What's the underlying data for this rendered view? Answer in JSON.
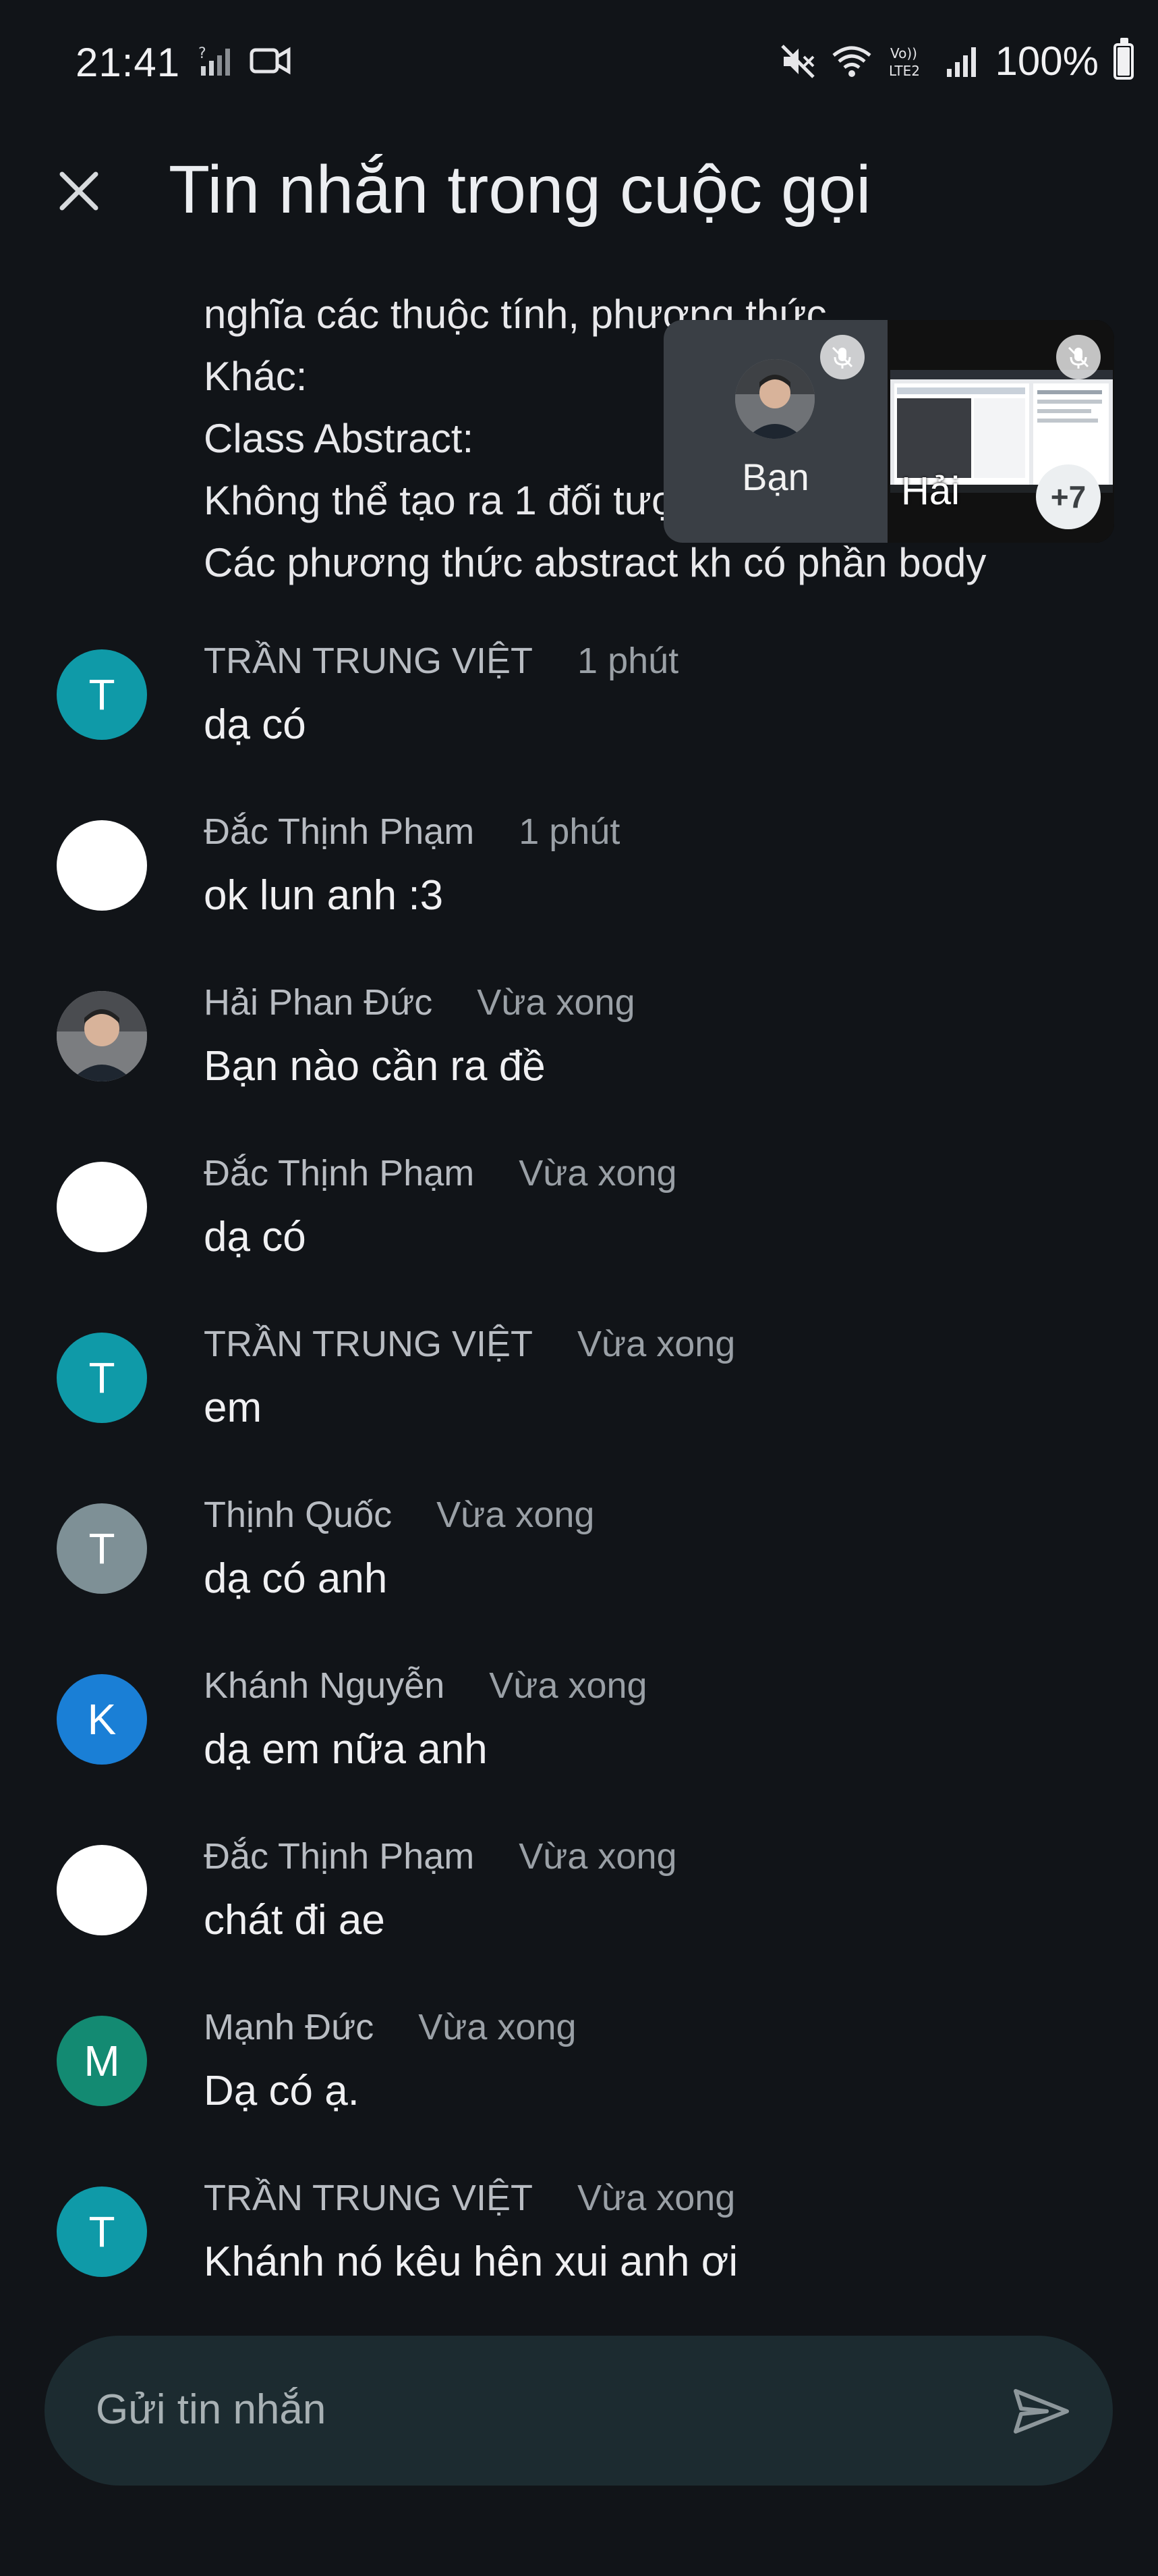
{
  "status_bar": {
    "time": "21:41",
    "battery": "100%",
    "icons": [
      "signal-off-icon",
      "video-camera-icon",
      "mute-icon",
      "wifi-icon",
      "volte-icon",
      "cell-signal-icon",
      "battery-icon"
    ],
    "volte_text": "Vo)) LTE2"
  },
  "header": {
    "close_icon": "close-icon",
    "title": "Tin nhắn trong cuộc gọi"
  },
  "partial_message": {
    "lines": [
      "nghĩa các thuộc tính, phương thức",
      "Khác:",
      "Class Abstract:",
      "Không thể tạo ra 1 đối tượng",
      "Các phương thức abstract kh có phần body"
    ]
  },
  "messages": [
    {
      "sender": "TRẦN TRUNG VIỆT",
      "time": "1 phút",
      "text": "dạ có",
      "initial": "T",
      "avatar_color": "#0f9aa8"
    },
    {
      "sender": "Đắc Thịnh Phạm",
      "time": "1 phút",
      "text": "ok lun anh :3",
      "initial": "",
      "avatar_color": "#ffffff"
    },
    {
      "sender": "Hải Phan Đức",
      "time": "Vừa xong",
      "text": "Bạn nào cần ra đề",
      "initial": "",
      "avatar_color": "#8d8f93"
    },
    {
      "sender": "Đắc Thịnh Phạm",
      "time": "Vừa xong",
      "text": "dạ có",
      "initial": "",
      "avatar_color": "#ffffff"
    },
    {
      "sender": "TRẦN TRUNG VIỆT",
      "time": "Vừa xong",
      "text": "em",
      "initial": "T",
      "avatar_color": "#0f9aa8"
    },
    {
      "sender": "Thịnh Quốc",
      "time": "Vừa xong",
      "text": "dạ có anh",
      "initial": "T",
      "avatar_color": "#7e9096"
    },
    {
      "sender": "Khánh Nguyễn",
      "time": "Vừa xong",
      "text": "dạ em nữa anh",
      "initial": "K",
      "avatar_color": "#1a7fd6"
    },
    {
      "sender": "Đắc Thịnh Phạm",
      "time": "Vừa xong",
      "text": "chát đi ae",
      "initial": "",
      "avatar_color": "#ffffff"
    },
    {
      "sender": "Mạnh Đức",
      "time": "Vừa xong",
      "text": "Dạ có ạ.",
      "initial": "M",
      "avatar_color": "#138a72"
    },
    {
      "sender": "TRẦN TRUNG VIỆT",
      "time": "Vừa xong",
      "text": "Khánh nó kêu hên xui anh ơi",
      "initial": "T",
      "avatar_color": "#0f9aa8"
    }
  ],
  "pip": {
    "self_label": "Bạn",
    "other_name": "Hải",
    "more_count": "+7",
    "mic_icon": "mic-off-icon"
  },
  "composer": {
    "placeholder": "Gửi tin nhắn",
    "send_icon": "send-icon"
  }
}
